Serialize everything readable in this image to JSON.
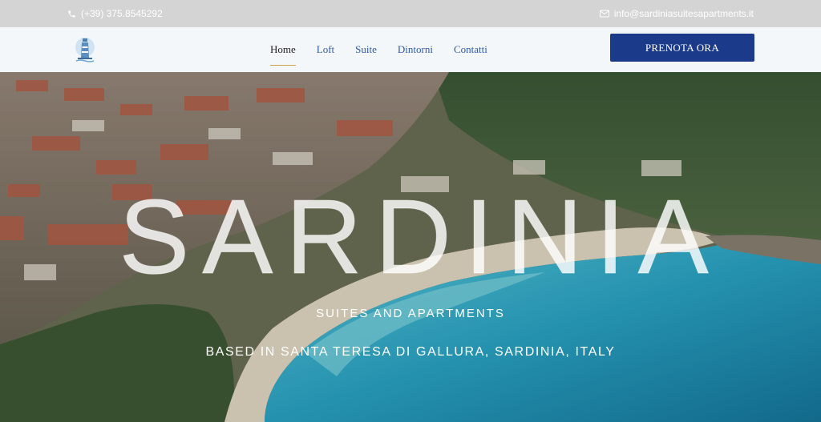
{
  "topbar": {
    "phone": "(+39) 375.8545292",
    "email": "info@sardiniasuitesapartments.it",
    "phone_icon": "phone-icon",
    "email_icon": "envelope-icon"
  },
  "nav": {
    "logo_icon": "lighthouse-icon",
    "items": [
      {
        "label": "Home",
        "active": true
      },
      {
        "label": "Loft"
      },
      {
        "label": "Suite"
      },
      {
        "label": "Dintorni"
      },
      {
        "label": "Contatti"
      }
    ],
    "cta_label": "PRENOTA ORA"
  },
  "hero": {
    "title": "SARDINIA",
    "subtitle": "SUITES AND APARTMENTS",
    "location": "BASED IN SANTA TERESA DI GALLURA, SARDINIA, ITALY"
  },
  "colors": {
    "topbar_bg": "#d4d4d4",
    "nav_bg": "#f4f7fa",
    "nav_link": "#2e5aa8",
    "cta_bg": "#1c3a8a",
    "sea": "#2aa6c8"
  }
}
